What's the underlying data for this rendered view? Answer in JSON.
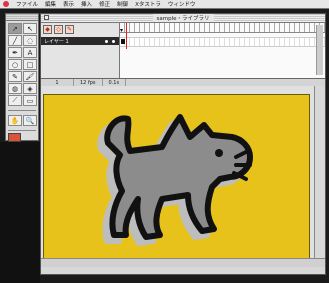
{
  "menubar": {
    "items": [
      "ファイル",
      "編集",
      "表示",
      "挿入",
      "修正",
      "制御",
      "Xタストラ",
      "ウィンドウ"
    ]
  },
  "document": {
    "title": "sample・ライブラリ",
    "timeline": {
      "layer_name": "レイヤー 1"
    },
    "status": {
      "frame": "1",
      "fps": "12 fps",
      "time": "0.1s"
    }
  },
  "colors": {
    "stage_background": "#e6c21a",
    "dog_fill": "#8c8c8c",
    "dog_outline": "#111111",
    "dog_shadow": "#bdbdbd"
  },
  "icons": {
    "tools": [
      "arrow-icon",
      "subselect-icon",
      "line-icon",
      "lasso-icon",
      "pen-icon",
      "text-icon",
      "oval-icon",
      "rect-icon",
      "pencil-icon",
      "brush-icon",
      "ink-bottle-icon",
      "paint-bucket-icon",
      "dropper-icon",
      "eraser-icon"
    ]
  }
}
